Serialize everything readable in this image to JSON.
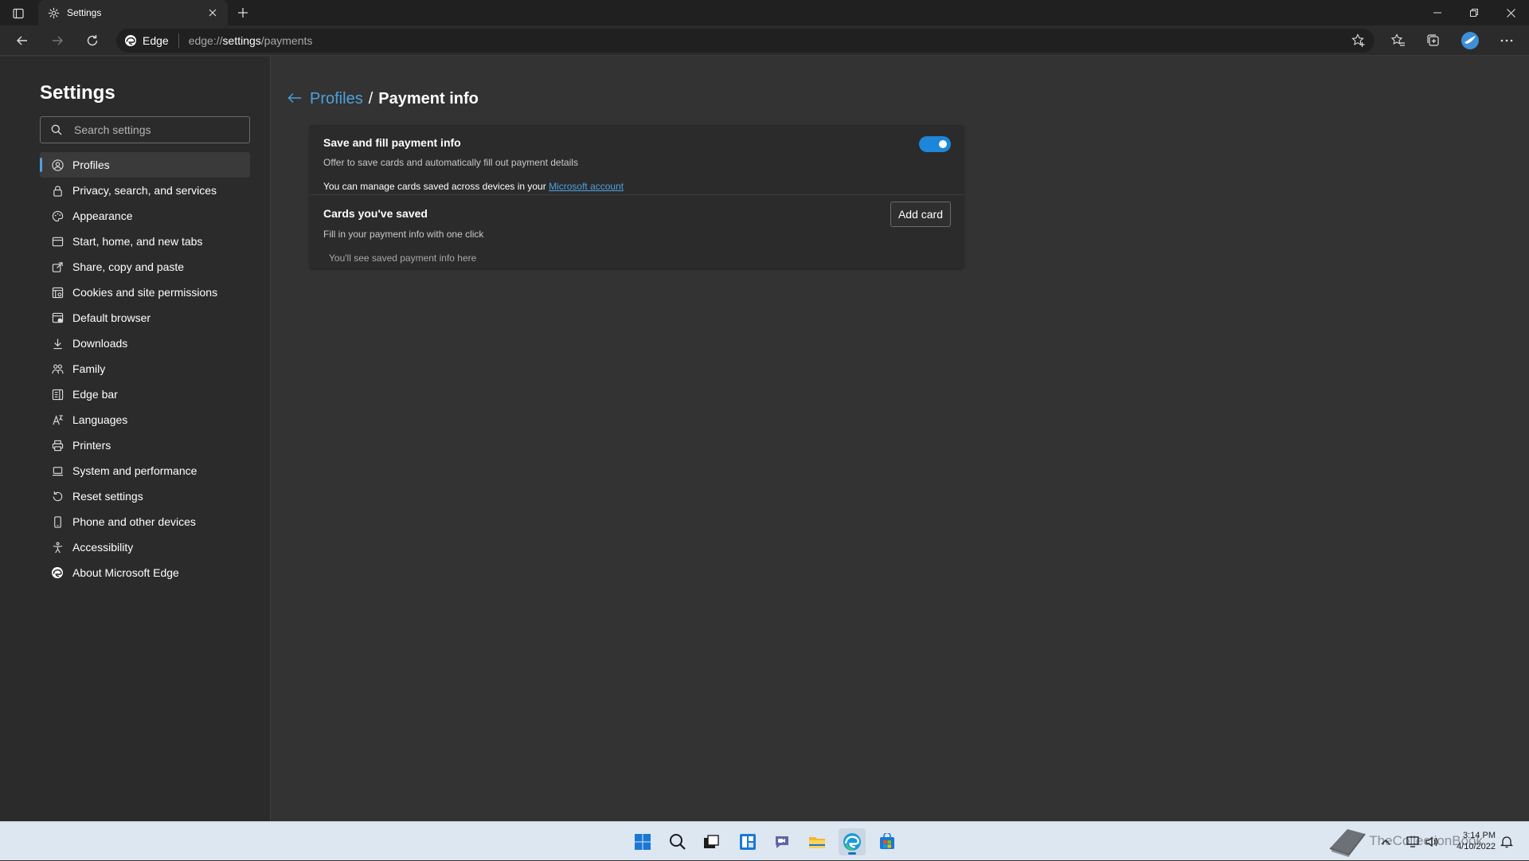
{
  "browser": {
    "tab_title": "Settings",
    "omnibox_brand": "Edge",
    "url_prefix": "edge://",
    "url_host": "settings",
    "url_path": "/payments"
  },
  "sidebar": {
    "title": "Settings",
    "search_placeholder": "Search settings",
    "items": [
      {
        "label": "Profiles",
        "icon": "profile-icon",
        "active": true
      },
      {
        "label": "Privacy, search, and services",
        "icon": "lock-icon"
      },
      {
        "label": "Appearance",
        "icon": "appearance-icon"
      },
      {
        "label": "Start, home, and new tabs",
        "icon": "home-tabs-icon"
      },
      {
        "label": "Share, copy and paste",
        "icon": "share-icon"
      },
      {
        "label": "Cookies and site permissions",
        "icon": "cookies-icon"
      },
      {
        "label": "Default browser",
        "icon": "default-browser-icon"
      },
      {
        "label": "Downloads",
        "icon": "download-icon"
      },
      {
        "label": "Family",
        "icon": "family-icon"
      },
      {
        "label": "Edge bar",
        "icon": "edge-bar-icon"
      },
      {
        "label": "Languages",
        "icon": "languages-icon"
      },
      {
        "label": "Printers",
        "icon": "printer-icon"
      },
      {
        "label": "System and performance",
        "icon": "laptop-icon"
      },
      {
        "label": "Reset settings",
        "icon": "reset-icon"
      },
      {
        "label": "Phone and other devices",
        "icon": "phone-icon"
      },
      {
        "label": "Accessibility",
        "icon": "accessibility-icon"
      },
      {
        "label": "About Microsoft Edge",
        "icon": "edge-logo-icon"
      }
    ]
  },
  "main": {
    "breadcrumb_parent": "Profiles",
    "breadcrumb_sep": "/",
    "breadcrumb_current": "Payment info",
    "save_fill": {
      "title": "Save and fill payment info",
      "subtitle": "Offer to save cards and automatically fill out payment details",
      "note_text": "You can manage cards saved across devices in your ",
      "note_link": "Microsoft account",
      "enabled": true
    },
    "cards": {
      "title": "Cards you've saved",
      "subtitle": "Fill in your payment info with one click",
      "add_label": "Add card",
      "empty_text": "You'll see saved payment info here"
    }
  },
  "taskbar": {
    "time": "3:14 PM",
    "date": "4/10/2022",
    "watermark": "TheCollectionBook"
  },
  "colors": {
    "accent": "#4ca0e0",
    "toggle_on": "#1d86d8",
    "background": "#333333",
    "sidebar": "#2b2b2b"
  }
}
